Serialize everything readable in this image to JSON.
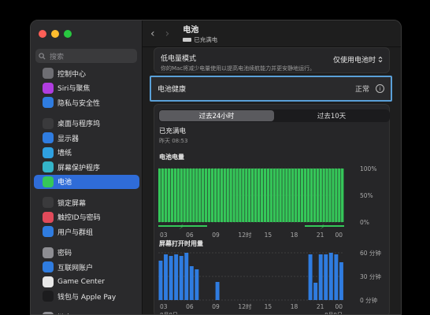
{
  "window": {
    "traffic_colors": [
      "#ff5f57",
      "#febc2e",
      "#28c840"
    ]
  },
  "sidebar": {
    "search_placeholder": "搜索",
    "items": [
      {
        "label": "控制中心",
        "icon": "control-center-icon",
        "color": "#6e6e73",
        "group": 0
      },
      {
        "label": "Siri与聚焦",
        "icon": "siri-icon",
        "color": "#b03de0",
        "group": 0
      },
      {
        "label": "隐私与安全性",
        "icon": "privacy-hand-icon",
        "color": "#2f7ce0",
        "group": 0
      },
      {
        "label": "桌面与程序坞",
        "icon": "desktop-dock-icon",
        "color": "#3a3a3c",
        "group": 1
      },
      {
        "label": "显示器",
        "icon": "display-icon",
        "color": "#2f7ce0",
        "group": 1
      },
      {
        "label": "墙纸",
        "icon": "wallpaper-icon",
        "color": "#2fa0e0",
        "group": 1
      },
      {
        "label": "屏幕保护程序",
        "icon": "screensaver-icon",
        "color": "#34b4c8",
        "group": 1
      },
      {
        "label": "电池",
        "icon": "battery-icon",
        "color": "#35c759",
        "group": 1,
        "selected": true
      },
      {
        "label": "锁定屏幕",
        "icon": "lock-screen-icon",
        "color": "#3a3a3c",
        "group": 2
      },
      {
        "label": "触控ID与密码",
        "icon": "touch-id-icon",
        "color": "#e04a5a",
        "group": 2
      },
      {
        "label": "用户与群组",
        "icon": "users-icon",
        "color": "#2f7ce0",
        "group": 2
      },
      {
        "label": "密码",
        "icon": "key-icon",
        "color": "#8e8e93",
        "group": 3
      },
      {
        "label": "互联网账户",
        "icon": "at-icon",
        "color": "#2f7ce0",
        "group": 3
      },
      {
        "label": "Game Center",
        "icon": "game-center-icon",
        "color": "#e8e8e8",
        "group": 3
      },
      {
        "label": "钱包与 Apple Pay",
        "icon": "wallet-icon",
        "color": "#1c1c1e",
        "group": 3
      },
      {
        "label": "键盘",
        "icon": "keyboard-icon",
        "color": "#8e8e93",
        "group": 4
      }
    ]
  },
  "header": {
    "title": "电池",
    "subtitle": "已充满电",
    "back": "‹",
    "forward": "›"
  },
  "low_power": {
    "label": "低电量模式",
    "desc": "你的Mac将减少电量使用以提高电池续航能力并更安静地运行。",
    "value": "仅使用电池时"
  },
  "health": {
    "label": "电池健康",
    "status": "正常",
    "info": "i"
  },
  "tabs": [
    {
      "label": "过去24小时",
      "active": true
    },
    {
      "label": "过去10天",
      "active": false
    }
  ],
  "charged": {
    "line1": "已充满电",
    "line2": "昨天 08:53"
  },
  "chart_data": [
    {
      "type": "area",
      "title": "电池电量",
      "x": [
        "03",
        "06",
        "09",
        "12时",
        "15",
        "18",
        "21",
        "00"
      ],
      "values": [
        100,
        100,
        100,
        100,
        100,
        100,
        100,
        100
      ],
      "ylim": [
        0,
        100
      ],
      "yticks": [
        "100%",
        "50%",
        "0%"
      ],
      "color": "#35c759"
    },
    {
      "type": "bar",
      "title": "屏幕打开时用量",
      "x": [
        "03",
        "06",
        "09",
        "12时",
        "15",
        "18",
        "21",
        "00"
      ],
      "xsub": [
        "8月8日",
        "",
        "",
        "",
        "",
        "",
        "",
        "8月9日"
      ],
      "values": [
        50,
        58,
        56,
        58,
        56,
        60,
        43,
        39,
        0,
        0,
        0,
        23,
        0,
        0,
        0,
        0,
        0,
        0,
        0,
        0,
        0,
        0,
        0,
        0,
        0,
        0,
        0,
        0,
        0,
        58,
        22,
        58,
        58,
        60,
        58,
        48
      ],
      "ylim": [
        0,
        60
      ],
      "yticks": [
        "60 分钟",
        "30 分钟",
        "0 分钟"
      ],
      "color": "#2f7ce0"
    }
  ]
}
